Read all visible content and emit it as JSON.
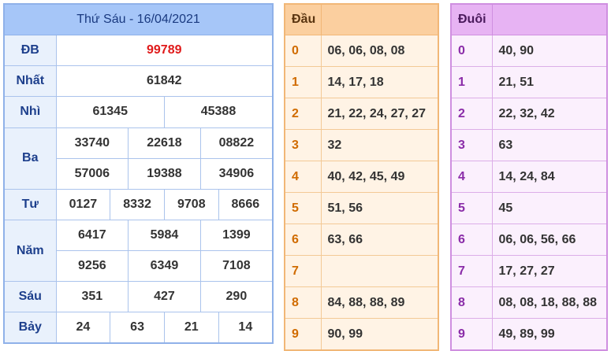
{
  "result": {
    "title": "Thứ Sáu - 16/04/2021",
    "rows": {
      "db": {
        "label": "ĐB",
        "values": [
          "99789"
        ]
      },
      "nhat": {
        "label": "Nhất",
        "values": [
          "61842"
        ]
      },
      "nhi": {
        "label": "Nhì",
        "values": [
          "61345",
          "45388"
        ]
      },
      "ba": {
        "label": "Ba",
        "values": [
          "33740",
          "22618",
          "08822",
          "57006",
          "19388",
          "34906"
        ]
      },
      "tu": {
        "label": "Tư",
        "values": [
          "0127",
          "8332",
          "9708",
          "8666"
        ]
      },
      "nam": {
        "label": "Năm",
        "values": [
          "6417",
          "5984",
          "1399",
          "9256",
          "6349",
          "7108"
        ]
      },
      "sau": {
        "label": "Sáu",
        "values": [
          "351",
          "427",
          "290"
        ]
      },
      "bay": {
        "label": "Bảy",
        "values": [
          "24",
          "63",
          "21",
          "14"
        ]
      }
    },
    "highlight_color": "#e01a1a"
  },
  "dau": {
    "header": "Đầu",
    "rows": [
      {
        "digit": "0",
        "numbers": "06, 06, 08, 08"
      },
      {
        "digit": "1",
        "numbers": "14, 17, 18"
      },
      {
        "digit": "2",
        "numbers": "21, 22, 24, 27, 27"
      },
      {
        "digit": "3",
        "numbers": "32"
      },
      {
        "digit": "4",
        "numbers": "40, 42, 45, 49"
      },
      {
        "digit": "5",
        "numbers": "51, 56"
      },
      {
        "digit": "6",
        "numbers": "63, 66"
      },
      {
        "digit": "7",
        "numbers": ""
      },
      {
        "digit": "8",
        "numbers": "84, 88, 88, 89"
      },
      {
        "digit": "9",
        "numbers": "90, 99"
      }
    ]
  },
  "duoi": {
    "header": "Đuôi",
    "rows": [
      {
        "digit": "0",
        "numbers": "40, 90"
      },
      {
        "digit": "1",
        "numbers": "21, 51"
      },
      {
        "digit": "2",
        "numbers": "22, 32, 42"
      },
      {
        "digit": "3",
        "numbers": "63"
      },
      {
        "digit": "4",
        "numbers": "14, 24, 84"
      },
      {
        "digit": "5",
        "numbers": "45"
      },
      {
        "digit": "6",
        "numbers": "06, 06, 56, 66"
      },
      {
        "digit": "7",
        "numbers": "17, 27, 27"
      },
      {
        "digit": "8",
        "numbers": "08, 08, 18, 88, 88"
      },
      {
        "digit": "9",
        "numbers": "49, 89, 99"
      }
    ]
  }
}
